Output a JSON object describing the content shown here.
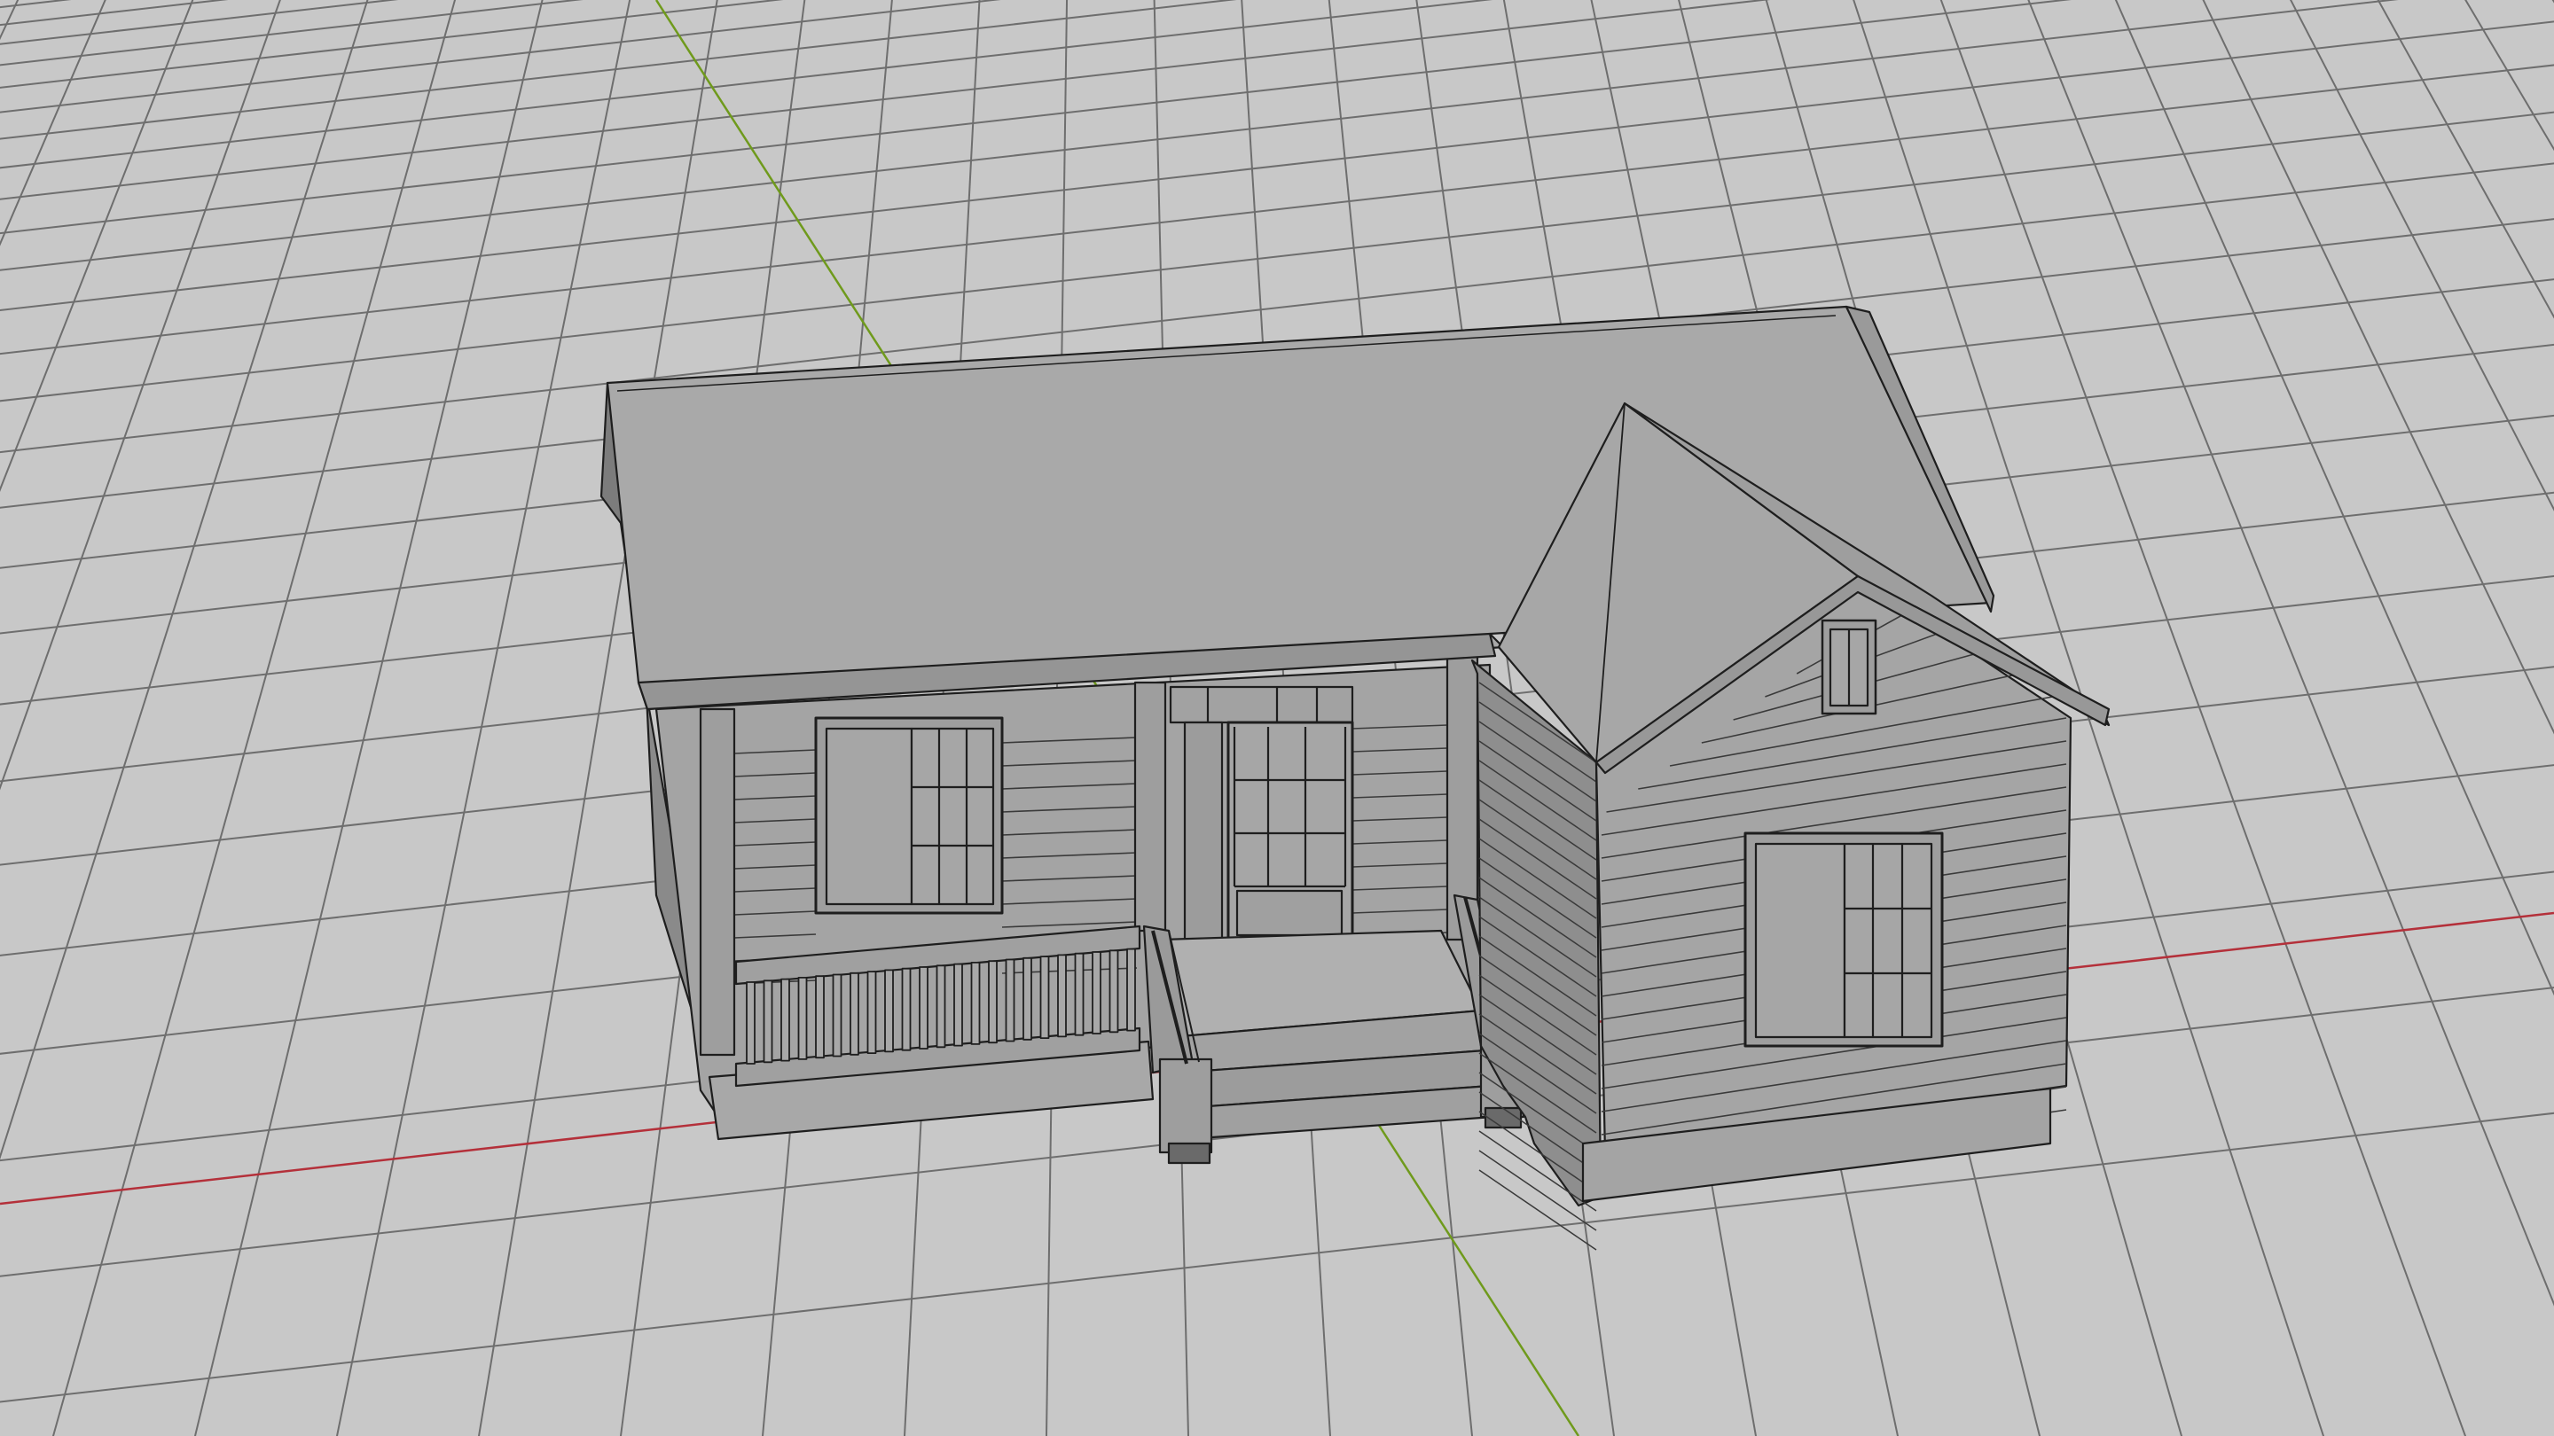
{
  "viewport": {
    "view_mode": "perspective",
    "display_mode": "shaded-wireframe",
    "colors": {
      "background": "#c8c8c8",
      "grid_line": "#6e6e6e",
      "x_axis": "#b4303a",
      "y_axis": "#6f9a1c",
      "model_face": "#a8a8a8",
      "model_edge": "#1e1e1e"
    }
  },
  "model": {
    "name": "house",
    "parts": [
      "main-roof",
      "gable-roof",
      "front-wall",
      "porch",
      "porch-railing",
      "front-steps",
      "front-door",
      "left-window",
      "right-window",
      "gable-vent"
    ]
  }
}
